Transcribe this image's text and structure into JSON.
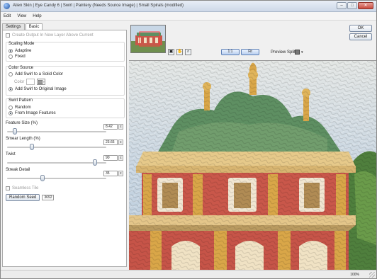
{
  "window": {
    "title": "Alien Skin | Eye Candy 6 | Swirl | Paintery (Needs Source Image) | Small Spirals (modified)",
    "controls": {
      "minimize": "–",
      "maximize": "□",
      "close": "✕"
    }
  },
  "menu": {
    "items": [
      "Edit",
      "View",
      "Help"
    ]
  },
  "tabs": [
    "Settings",
    "Basic"
  ],
  "basic": {
    "create_output": "Create Output In New Layer Above Current",
    "scaling_mode": {
      "title": "Scaling Mode",
      "options": [
        "Adaptive",
        "Fixed"
      ],
      "selected": "Adaptive"
    },
    "color_source": {
      "title": "Color Source",
      "option_solid": "Add Swirl to a Solid Color",
      "color_label": "Color",
      "option_original": "Add Swirl to Original Image",
      "selected": "Add Swirl to Original Image"
    },
    "swirl_pattern": {
      "title": "Swirl Pattern",
      "options": [
        "Random",
        "From Image Features"
      ],
      "selected": "From Image Features"
    },
    "sliders": [
      {
        "label": "Feature Size (%)",
        "value": "8.42",
        "fraction": 0.06
      },
      {
        "label": "Smear Length (%)",
        "value": "23.66",
        "fraction": 0.24
      },
      {
        "label": "Twist",
        "value": "90",
        "fraction": 0.9
      },
      {
        "label": "Streak Detail",
        "value": "35",
        "fraction": 0.35
      }
    ],
    "seamless_tile": "Seamless Tile",
    "random_seed_button": "Random Seed",
    "random_seed_value": "3692"
  },
  "right": {
    "ok": "OK",
    "cancel": "Cancel",
    "zoom_1_1": "1:1",
    "zoom_fit": "Fit",
    "preview_split_label": "Preview Split:"
  },
  "status": {
    "zoom": "100%"
  },
  "colors": {
    "accent": "#5b7eb5",
    "panel": "#f0f0f0",
    "preview_sky": "#c7d6e6",
    "dome_green": "#5e8f62",
    "wall_red": "#c9574a",
    "ornament_gold": "#d9a648"
  },
  "icons": {
    "hand": "hand-tool-icon",
    "zoom": "zoom-tool-icon",
    "compare": "compare-tool-icon"
  }
}
